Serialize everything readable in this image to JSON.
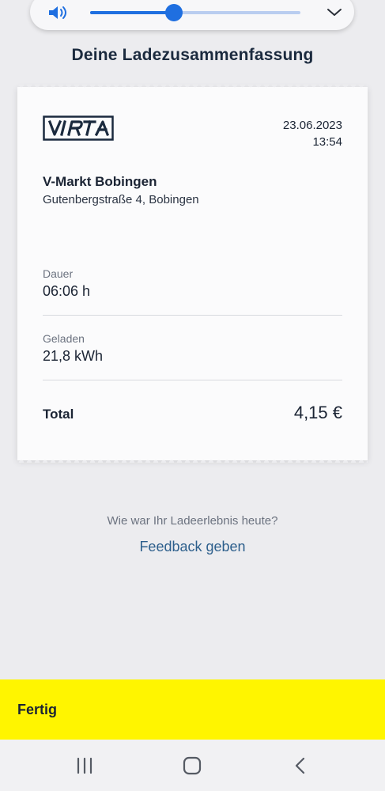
{
  "overlay": {
    "volume_level": 0.4,
    "volume_icon": "speaker-icon",
    "expand_icon": "chevron-down-icon"
  },
  "page": {
    "title": "Deine Ladezusammenfassung"
  },
  "receipt": {
    "logo_text": "VIRTA",
    "date": "23.06.2023",
    "time": "13:54",
    "station_name": "V-Markt Bobingen",
    "station_address": "Gutenbergstraße 4, Bobingen",
    "duration_label": "Dauer",
    "duration_value": "06:06 h",
    "charged_label": "Geladen",
    "charged_value": "21,8 kWh",
    "total_label": "Total",
    "total_value": "4,15 €"
  },
  "feedback": {
    "question": "Wie war Ihr Ladeerlebnis heute?",
    "link": "Feedback geben"
  },
  "footer": {
    "done_label": "Fertig"
  },
  "nav": {
    "recents_icon": "recent-apps-icon",
    "home_icon": "home-icon",
    "back_icon": "back-icon"
  },
  "colors": {
    "accent_yellow": "#fff500",
    "link_blue": "#2d5f8c",
    "volume_blue": "#1f6fe0",
    "background": "#ececef"
  }
}
